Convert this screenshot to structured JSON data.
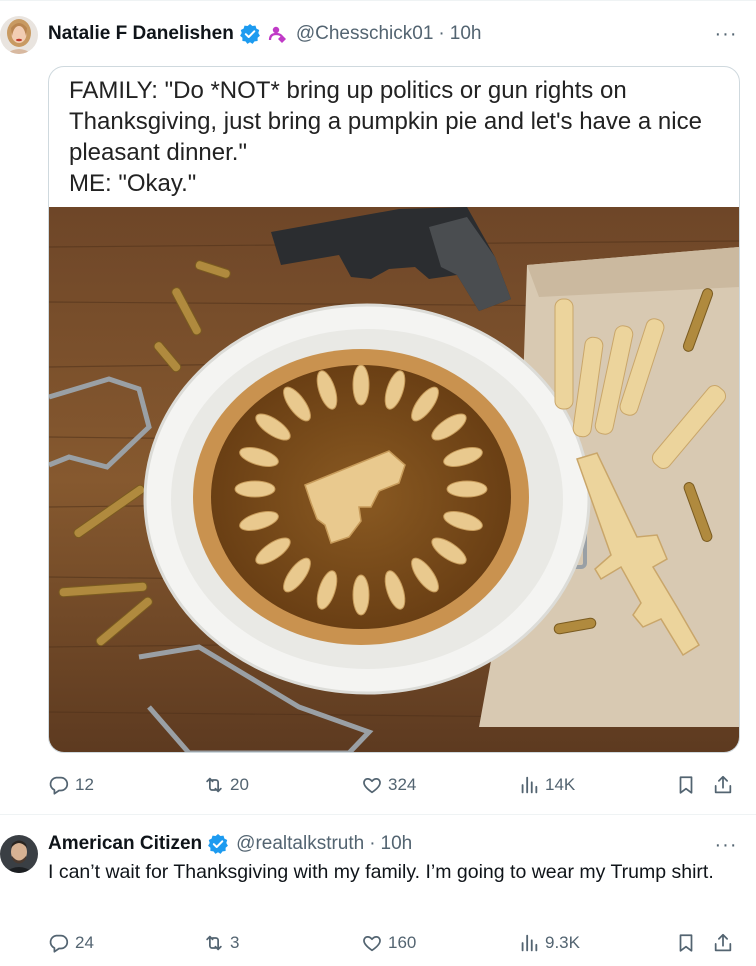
{
  "tweets": [
    {
      "author": "Natalie F Danelishen",
      "handle": "@Chesschick01",
      "separator": "·",
      "time": "10h",
      "more": "···",
      "meme_caption": [
        "FAMILY: \"Do *NOT* bring up politics or gun rights on",
        "Thanksgiving, just bring a pumpkin pie and let's have a nice",
        "pleasant dinner.\"",
        "ME: \"Okay.\""
      ],
      "replies": "12",
      "reposts": "20",
      "likes": "324",
      "views": "14K"
    },
    {
      "author": "American Citizen",
      "handle": "@realtalkstruth",
      "separator": "·",
      "time": "10h",
      "more": "···",
      "text": "I can’t wait for Thanksgiving with my family. I’m going to wear my Trump shirt.",
      "replies": "24",
      "reposts": "3",
      "likes": "160",
      "views": "9.3K"
    }
  ],
  "icons": {
    "verified": "verified-badge-icon",
    "affiliation": "affiliation-badge-icon",
    "reply": "reply-icon",
    "repost": "repost-icon",
    "like": "heart-icon",
    "views": "views-icon",
    "bookmark": "bookmark-icon",
    "share": "share-icon"
  },
  "colors": {
    "verified_blue": "#1d9bf0",
    "affiliation_purple": "#c03ac7",
    "secondary_text": "#536471",
    "primary_text": "#0f1419",
    "divider": "#eff3f4"
  }
}
